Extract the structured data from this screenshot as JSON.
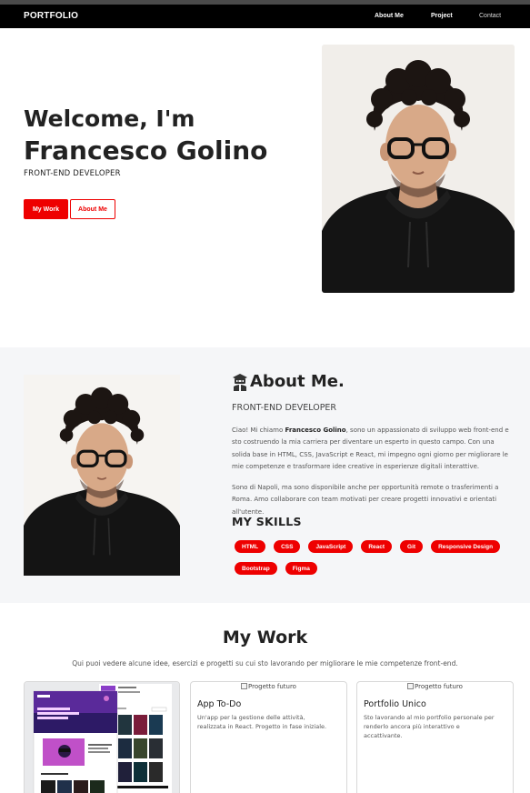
{
  "navbar": {
    "brand": "PORTFOLIO",
    "links": [
      "About Me",
      "Project",
      "Contact"
    ]
  },
  "hero": {
    "welcome": "Welcome, I'm",
    "name": "Francesco Golino",
    "role": "FRONT-END DEVELOPER",
    "primary_button": "My Work",
    "secondary_button": "About Me",
    "photo_icon": "portrait-photo"
  },
  "about": {
    "title_icon": "ninja-icon",
    "title": "About Me.",
    "role": "FRONT-END DEVELOPER",
    "p1_before": "Ciao! Mi chiamo ",
    "p1_name": "Francesco Golino",
    "p1_after": ", sono un appassionato di sviluppo web front-end e sto costruendo la mia carriera per diventare un esperto in questo campo. Con una solida base in HTML, CSS, JavaScript e React, mi impegno ogni giorno per migliorare le mie competenze e trasformare idee creative in esperienze digitali interattive.",
    "p2": "Sono di Napoli, ma sono disponibile anche per opportunità remote o trasferimenti a Roma. Amo collaborare con team motivati per creare progetti innovativi e orientati all'utente.",
    "skills_title": "MY SKILLS",
    "skills": [
      "HTML",
      "CSS",
      "JavaScript",
      "React",
      "Git",
      "Responsive Design",
      "Bootstrap",
      "Figma"
    ]
  },
  "work": {
    "title": "My Work",
    "subtitle": "Qui puoi vedere alcune idee, esercizi e progetti su cui sto lavorando per migliorare le mie competenze front-end.",
    "cards": [
      {
        "title": "",
        "image_alt": "",
        "description": "",
        "thumb_icon": "website-screenshot"
      },
      {
        "title": "App To-Do",
        "image_alt": "Progetto futuro",
        "description": "Un'app per la gestione delle attività, realizzata in React. Progetto in fase iniziale."
      },
      {
        "title": "Portfolio Unico",
        "image_alt": "Progetto futuro",
        "description": "Sto lavorando al mio portfolio personale per renderlo ancora più interattivo e accattivante."
      }
    ]
  },
  "colors": {
    "accent": "#ee0000",
    "navbar": "#000000",
    "section_bg": "#f5f6f8"
  }
}
